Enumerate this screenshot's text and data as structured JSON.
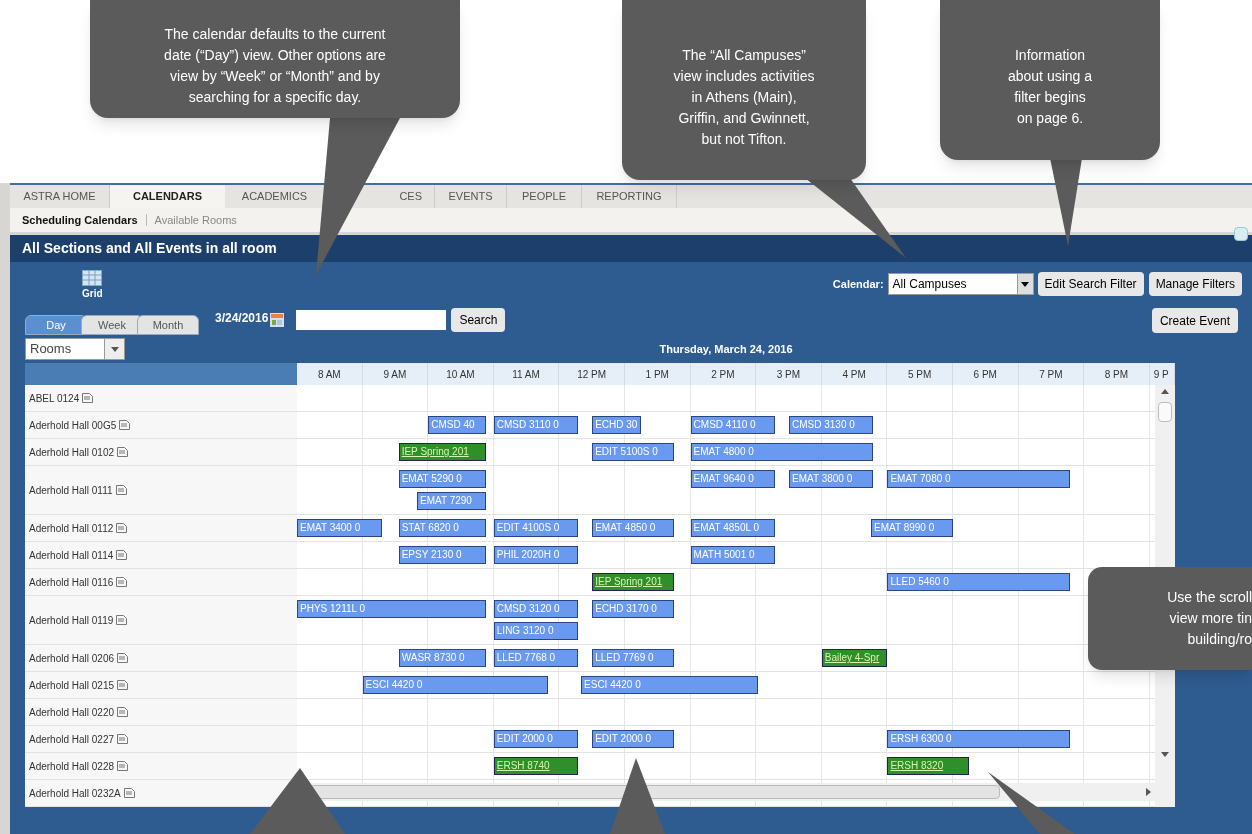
{
  "top_tabs": [
    {
      "label": "ASTRA HOME",
      "selected": false
    },
    {
      "label": "CALENDARS",
      "selected": true
    },
    {
      "label": "ACADEMICS",
      "selected": false
    },
    {
      "label": "CES",
      "selected": false
    },
    {
      "label": "EVENTS",
      "selected": false
    },
    {
      "label": "PEOPLE",
      "selected": false
    },
    {
      "label": "REPORTING",
      "selected": false
    }
  ],
  "sub_tabs": [
    {
      "label": "Scheduling Calendars",
      "selected": true
    },
    {
      "label": "Available Rooms",
      "selected": false
    }
  ],
  "page_title": "All Sections and All Events in all room",
  "view_icon_label": "Grid",
  "view_tabs": [
    {
      "label": "Day",
      "selected": true
    },
    {
      "label": "Week",
      "selected": false
    },
    {
      "label": "Month",
      "selected": false
    }
  ],
  "date": "3/24/2016",
  "search_button": "Search",
  "calendar_label": "Calendar:",
  "calendar_select": "All Campuses",
  "filter_buttons": [
    "Edit Search Filter",
    "Manage Filters"
  ],
  "create_button": "Create Event",
  "resource_select": "Rooms",
  "day_heading": "Thursday, March 24, 2016",
  "hours": [
    "8 AM",
    "9 AM",
    "10 AM",
    "11 AM",
    "12 PM",
    "1 PM",
    "2 PM",
    "3 PM",
    "4 PM",
    "5 PM",
    "6 PM",
    "7 PM",
    "8 PM",
    "9 P"
  ],
  "rooms": [
    {
      "name": "ABEL 0124"
    },
    {
      "name": "Aderhold Hall 00G5",
      "events": [
        {
          "label": "CMSD 40",
          "kind": "section"
        },
        {
          "label": "CMSD 3110 0",
          "kind": "section"
        },
        {
          "label": "ECHD 30",
          "kind": "section"
        },
        {
          "label": "CMSD 4110 0",
          "kind": "section"
        },
        {
          "label": "CMSD 3130 0",
          "kind": "section"
        }
      ]
    },
    {
      "name": "Aderhold Hall 0102",
      "events": [
        {
          "label": "IEP Spring 201",
          "kind": "event"
        },
        {
          "label": "EDIT 5100S 0",
          "kind": "section"
        },
        {
          "label": "EMAT 4800 0",
          "kind": "section"
        }
      ]
    },
    {
      "name": "Aderhold Hall 0111",
      "events": [
        {
          "label": "EMAT 5290 0",
          "kind": "section"
        },
        {
          "label": "EMAT 7290",
          "kind": "section"
        },
        {
          "label": "EMAT 9640 0",
          "kind": "section"
        },
        {
          "label": "EMAT 3800 0",
          "kind": "section"
        },
        {
          "label": "EMAT 7080 0",
          "kind": "section"
        }
      ]
    },
    {
      "name": "Aderhold Hall 0112",
      "events": [
        {
          "label": "EMAT 3400 0",
          "kind": "section"
        },
        {
          "label": "STAT 6820 0",
          "kind": "section"
        },
        {
          "label": "EDIT 4100S 0",
          "kind": "section"
        },
        {
          "label": "EMAT 4850 0",
          "kind": "section"
        },
        {
          "label": "EMAT 4850L 0",
          "kind": "section"
        },
        {
          "label": "EMAT 8990 0",
          "kind": "section"
        }
      ]
    },
    {
      "name": "Aderhold Hall 0114",
      "events": [
        {
          "label": "EPSY 2130 0",
          "kind": "section"
        },
        {
          "label": "PHIL 2020H 0",
          "kind": "section"
        },
        {
          "label": "MATH 5001 0",
          "kind": "section"
        }
      ]
    },
    {
      "name": "Aderhold Hall 0116",
      "events": [
        {
          "label": "IEP Spring 201",
          "kind": "event"
        },
        {
          "label": "LLED 5460 0",
          "kind": "section"
        }
      ]
    },
    {
      "name": "Aderhold Hall 0119",
      "events": [
        {
          "label": "PHYS 1211L 0",
          "kind": "section"
        },
        {
          "label": "CMSD 3120 0",
          "kind": "section"
        },
        {
          "label": "LING 3120 0",
          "kind": "section"
        },
        {
          "label": "ECHD 3170 0",
          "kind": "section"
        }
      ]
    },
    {
      "name": "Aderhold Hall 0206",
      "events": [
        {
          "label": "WASR 8730 0",
          "kind": "section"
        },
        {
          "label": "LLED 7768 0",
          "kind": "section"
        },
        {
          "label": "LLED 7769 0",
          "kind": "section"
        },
        {
          "label": "Bailey 4-Spr",
          "kind": "event"
        }
      ]
    },
    {
      "name": "Aderhold Hall 0215",
      "events": [
        {
          "label": "ESCI 4420 0",
          "kind": "section"
        },
        {
          "label": "ESCI 4420 0",
          "kind": "section"
        }
      ]
    },
    {
      "name": "Aderhold Hall 0220"
    },
    {
      "name": "Aderhold Hall 0227",
      "events": [
        {
          "label": "EDIT 2000 0",
          "kind": "section"
        },
        {
          "label": "EDIT 2000 0",
          "kind": "section"
        },
        {
          "label": "ERSH 6300 0",
          "kind": "section"
        }
      ]
    },
    {
      "name": "Aderhold Hall 0228",
      "events": [
        {
          "label": "ERSH 8740",
          "kind": "event"
        },
        {
          "label": "ERSH 8320",
          "kind": "event"
        }
      ]
    },
    {
      "name": "Aderhold Hall 0232A"
    }
  ],
  "callouts": [
    {
      "lines": [
        "The calendar defaults to the current",
        "date (“Day”) view. Other options are",
        "view by “Week” or “Month” and by",
        "searching for a specific day."
      ]
    },
    {
      "lines": [
        "The “All Campuses”",
        "view includes activities",
        "in Athens (Main),",
        "Griffin, and Gwinnett,",
        "but not Tifton."
      ]
    },
    {
      "lines": [
        "Information",
        "about using a",
        "filter begins",
        "on page 6."
      ]
    },
    {
      "lines": [
        "Use the scroll",
        "view more tin",
        "building/ro"
      ]
    }
  ]
}
